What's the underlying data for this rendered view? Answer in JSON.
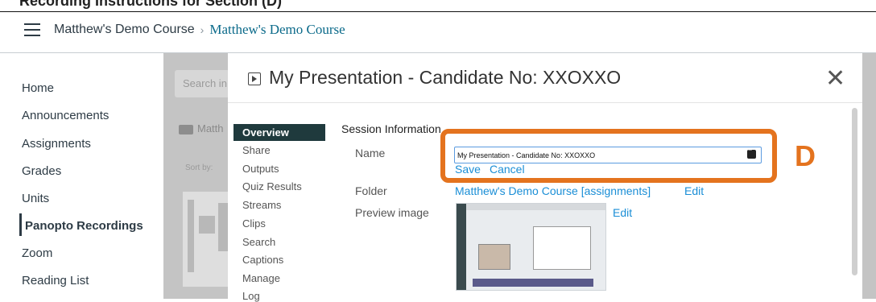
{
  "top_strip": {
    "cropped_text": "Recording Instructions for Section (D)"
  },
  "header": {
    "crumb_1": "Matthew's Demo Course",
    "separator": "›",
    "crumb_2": "Matthew's Demo Course"
  },
  "left_nav": {
    "items": [
      "Home",
      "Announcements",
      "Assignments",
      "Grades",
      "Units",
      "Panopto Recordings",
      "Zoom",
      "Reading List"
    ],
    "active": "Panopto Recordings"
  },
  "background": {
    "search_placeholder": "Search in",
    "folder_label": "Matth",
    "sort_by": "Sort by:"
  },
  "modal": {
    "title": "My Presentation - Candidate No: XXOXXO",
    "close_symbol": "✕",
    "tabs": [
      "Overview",
      "Share",
      "Outputs",
      "Quiz Results",
      "Streams",
      "Clips",
      "Search",
      "Captions",
      "Manage",
      "Log"
    ],
    "active_tab": "Overview",
    "section_heading": "Session Information",
    "name_label": "Name",
    "name_value": "My Presentation - Candidate No: XXOXXO",
    "save_label": "Save",
    "cancel_label": "Cancel",
    "folder_label": "Folder",
    "folder_value": "Matthew's Demo Course [assignments]",
    "folder_edit": "Edit",
    "preview_label": "Preview image",
    "preview_edit": "Edit"
  },
  "annotation": {
    "letter": "D",
    "color": "#e4731e"
  }
}
